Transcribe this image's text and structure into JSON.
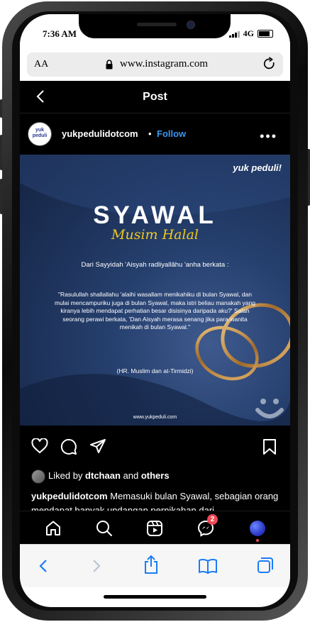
{
  "status_bar": {
    "time": "7:36 AM",
    "network": "4G"
  },
  "browser": {
    "text_size_label": "AA",
    "url": "www.instagram.com"
  },
  "header": {
    "title": "Post"
  },
  "post": {
    "username": "yukpedulidotcom",
    "separator": "•",
    "follow_label": "Follow",
    "more_label": "•••",
    "avatar_text": "yuk peduli",
    "image": {
      "brand": "yuk peduli!",
      "title": "SYAWAL",
      "subtitle": "Musim Halal",
      "intro": "Dari Sayyidah 'Aisyah radliyallâhu 'anha berkata :",
      "hadith": "\"Rasulullah shallallahu 'alaihi wasallam menikahiku di bulan Syawal, dan mulai mencampuriku juga di bulan Syawal, maka istri beliau manakah yang kiranya lebih mendapat perhatian besar disisinya daripada aku?' Salah seorang perawi berkata, 'Dan Aisyah merasa senang jika para wanita menikah di bulan Syawal.\"",
      "source": "(HR. Muslim dan at-Tirmidzi)",
      "site": "www.yukpeduli.com"
    },
    "liked_prefix": "Liked by",
    "liked_user": "dtchaan",
    "liked_and": "and",
    "liked_others": "others",
    "caption_user": "yukpedulidotcom",
    "caption_text": "Memasuki bulan Syawal, sebagian orang mendapat banyak undangan pernikahan dari"
  },
  "bottom_nav": {
    "badge_count": "2"
  },
  "colors": {
    "follow": "#3897f0",
    "accent_yellow": "#f1c81c",
    "badge": "#ed4956",
    "safari_icon": "#1a7cf5"
  }
}
